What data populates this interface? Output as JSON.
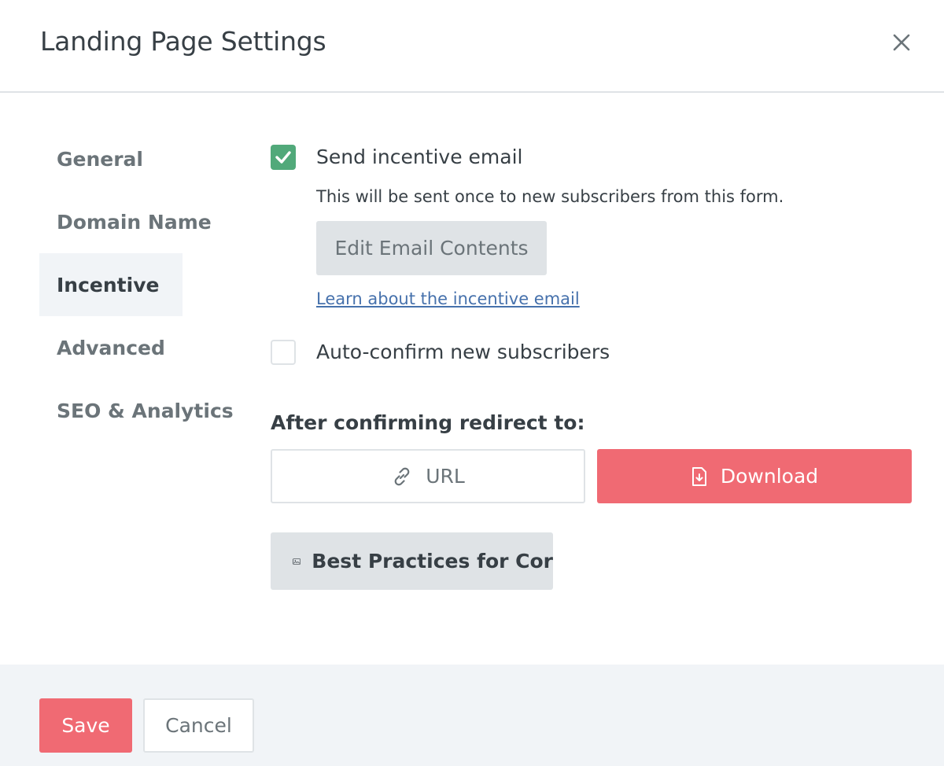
{
  "modal": {
    "title": "Landing Page Settings",
    "close_icon": "close-icon"
  },
  "sidebar": {
    "items": [
      {
        "label": "General",
        "active": false
      },
      {
        "label": "Domain Name",
        "active": false
      },
      {
        "label": "Incentive",
        "active": true
      },
      {
        "label": "Advanced",
        "active": false
      },
      {
        "label": "SEO & Analytics",
        "active": false
      }
    ]
  },
  "incentive": {
    "send_email": {
      "label": "Send incentive email",
      "checked": true,
      "help": "This will be sent once to new subscribers from this form."
    },
    "edit_button": "Edit Email Contents",
    "learn_link": "Learn about the incentive email",
    "auto_confirm": {
      "label": "Auto-confirm new subscribers",
      "checked": false
    },
    "redirect": {
      "label": "After confirming redirect to:",
      "options": [
        {
          "label": "URL",
          "icon": "link-icon",
          "selected": false
        },
        {
          "label": "Download",
          "icon": "file-download-icon",
          "selected": true
        }
      ]
    },
    "practice_button": {
      "label": "Best Practices for Cor",
      "icon": "image-icon"
    }
  },
  "footer": {
    "save": "Save",
    "cancel": "Cancel"
  },
  "colors": {
    "accent": "#f06a73",
    "checked": "#51a97a",
    "link": "#4671ac",
    "border": "#dfe3e6",
    "active_bg": "#f1f4f7"
  }
}
